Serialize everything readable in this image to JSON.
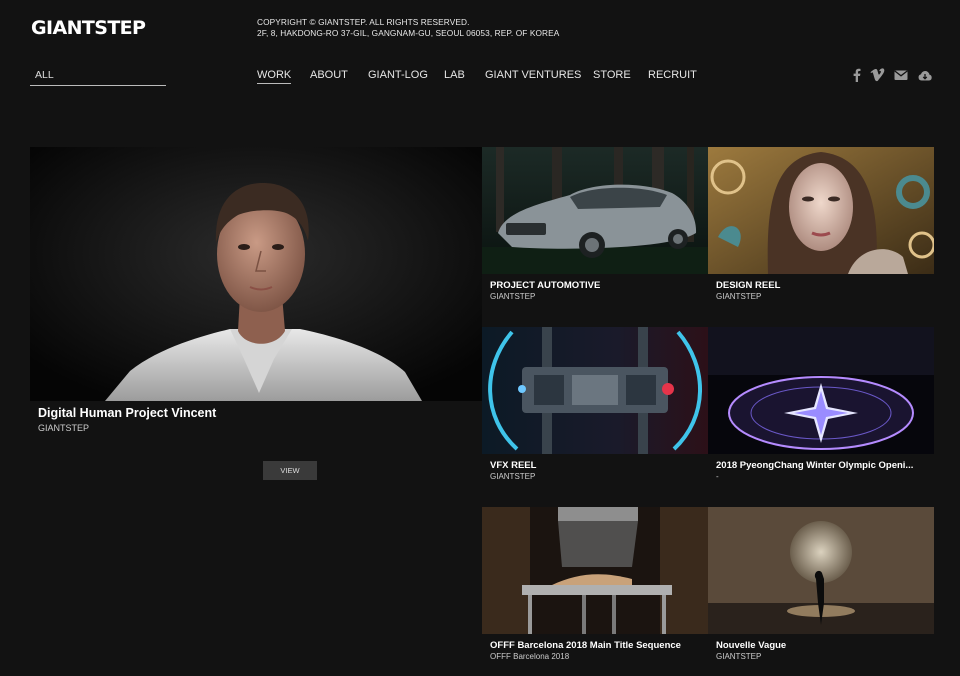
{
  "header": {
    "logo": "GIANTSTEP",
    "copyright_line1": "COPYRIGHT © GIANTSTEP. ALL RIGHTS RESERVED.",
    "copyright_line2": "2F, 8, HAKDONG-RO 37-GIL, GANGNAM-GU, SEOUL 06053, REP. OF KOREA"
  },
  "filter": {
    "selected": "ALL"
  },
  "nav": {
    "items": [
      {
        "label": "WORK",
        "active": true
      },
      {
        "label": "ABOUT"
      },
      {
        "label": "GIANT-LOG"
      },
      {
        "label": "LAB"
      },
      {
        "label": "GIANT VENTURES"
      },
      {
        "label": "STORE"
      },
      {
        "label": "RECRUIT"
      }
    ]
  },
  "social": [
    "facebook-icon",
    "vimeo-icon",
    "mail-icon",
    "cloud-download-icon"
  ],
  "featured": {
    "title": "Digital Human Project Vincent",
    "subtitle": "GIANTSTEP",
    "button": "VIEW"
  },
  "cards": [
    {
      "title": "PROJECT AUTOMOTIVE",
      "subtitle": "GIANTSTEP"
    },
    {
      "title": "DESIGN REEL",
      "subtitle": "GIANTSTEP"
    },
    {
      "title": "VFX REEL",
      "subtitle": "GIANTSTEP"
    },
    {
      "title": "2018 PyeongChang Winter Olympic Openi...",
      "subtitle": "-"
    },
    {
      "title": "OFFF Barcelona 2018 Main Title Sequence",
      "subtitle": "OFFF Barcelona 2018"
    },
    {
      "title": "Nouvelle Vague",
      "subtitle": "GIANTSTEP"
    }
  ]
}
